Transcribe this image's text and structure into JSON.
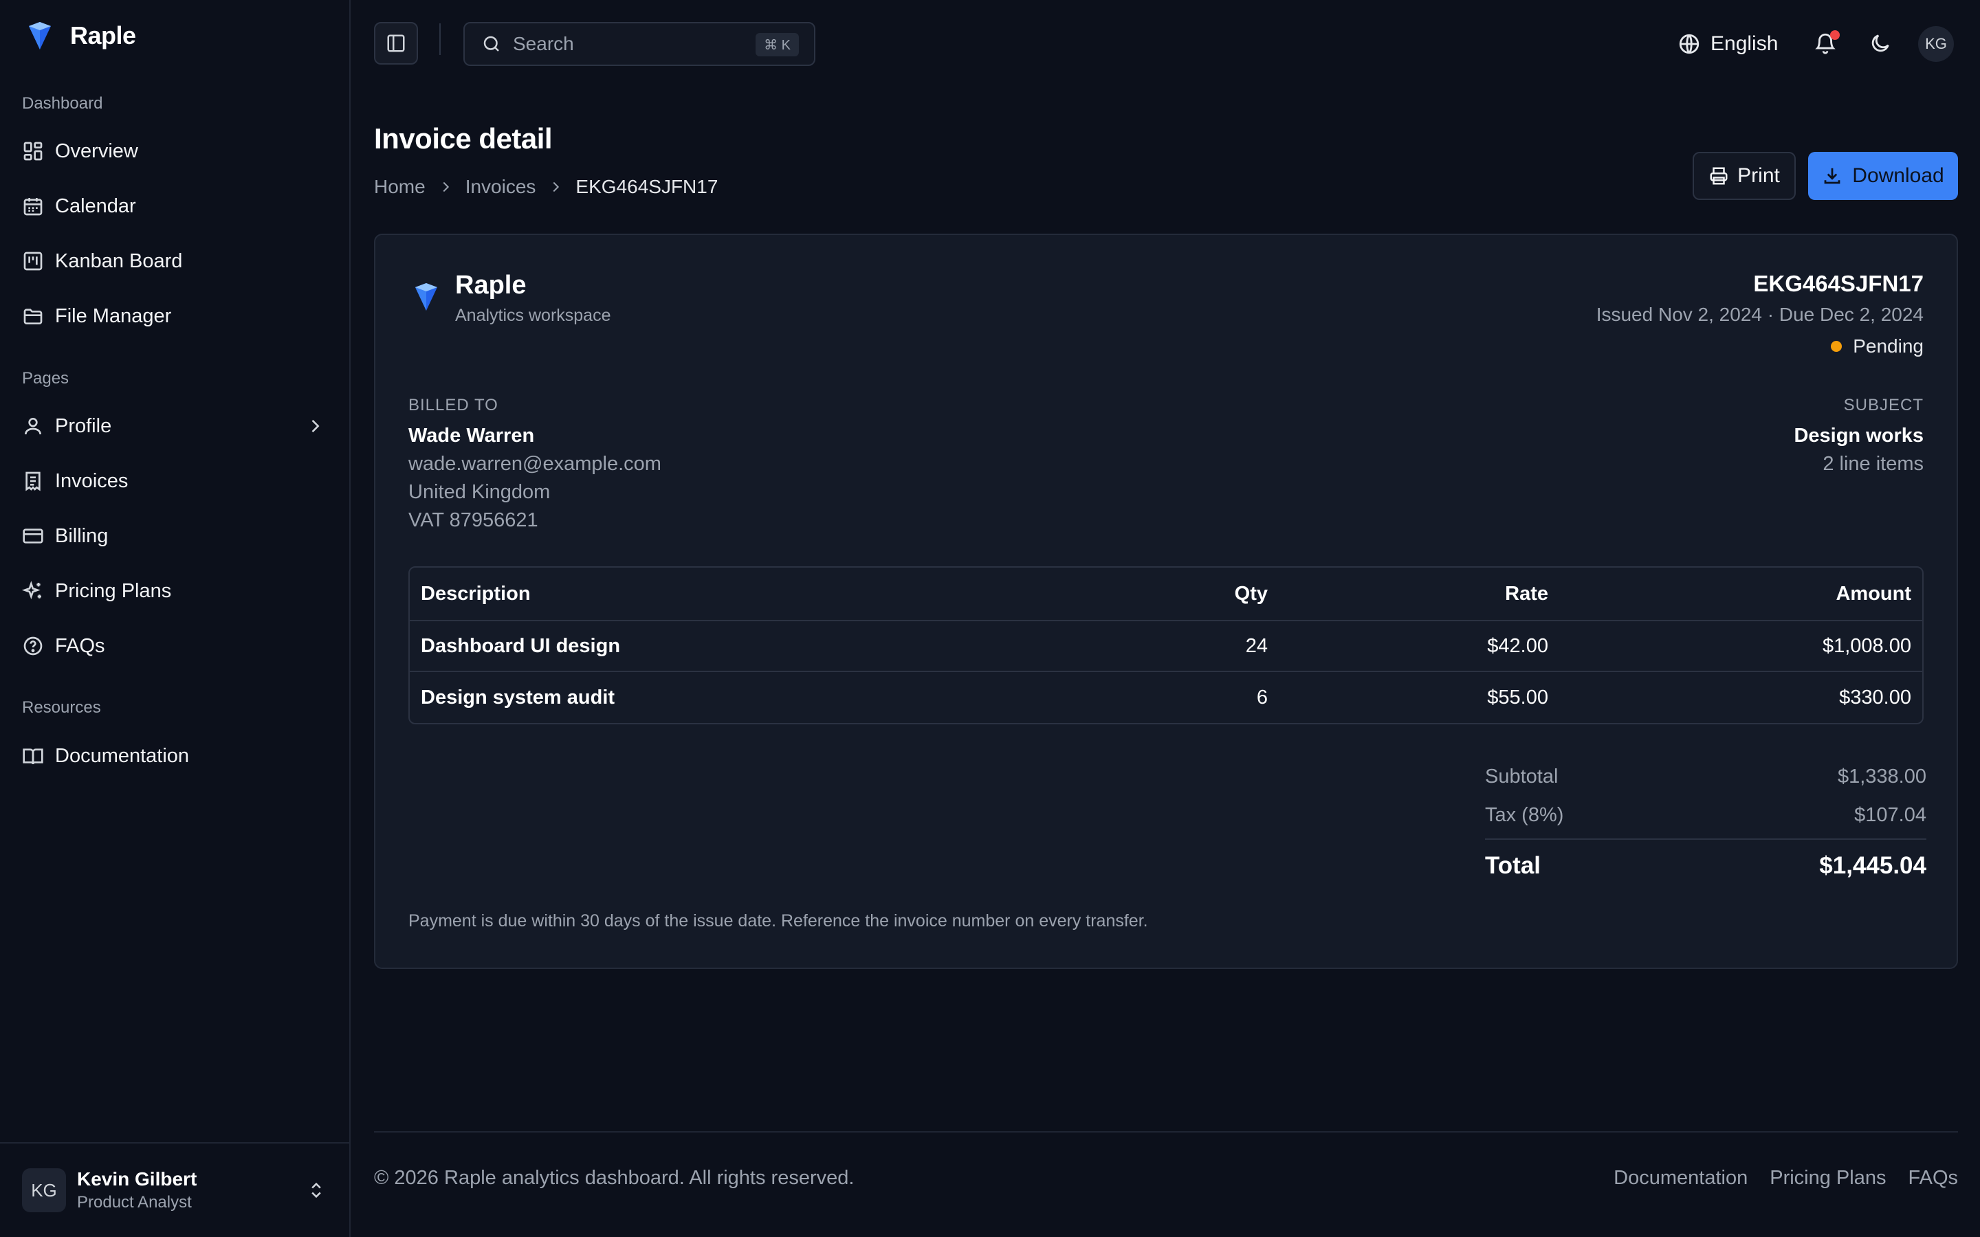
{
  "brand": {
    "name": "Raple",
    "accent": "#3b82f6"
  },
  "sidebar": {
    "sections": [
      {
        "label": "Dashboard",
        "items": [
          {
            "label": "Overview",
            "icon": "grid-icon"
          },
          {
            "label": "Calendar",
            "icon": "calendar-icon"
          },
          {
            "label": "Kanban Board",
            "icon": "kanban-icon"
          },
          {
            "label": "File Manager",
            "icon": "folder-icon"
          }
        ]
      },
      {
        "label": "Pages",
        "items": [
          {
            "label": "Profile",
            "icon": "user-icon",
            "has_submenu": true
          },
          {
            "label": "Invoices",
            "icon": "receipt-icon"
          },
          {
            "label": "Billing",
            "icon": "credit-card-icon"
          },
          {
            "label": "Pricing Plans",
            "icon": "sparkles-icon"
          },
          {
            "label": "FAQs",
            "icon": "help-circle-icon"
          }
        ]
      },
      {
        "label": "Resources",
        "items": [
          {
            "label": "Documentation",
            "icon": "book-icon"
          }
        ]
      }
    ],
    "user": {
      "initials": "KG",
      "name": "Kevin Gilbert",
      "role": "Product Analyst"
    }
  },
  "topbar": {
    "search_placeholder": "Search",
    "search_shortcut": "⌘ K",
    "language": "English",
    "avatar_initials": "KG",
    "has_notification": true
  },
  "page": {
    "title": "Invoice detail",
    "breadcrumbs": [
      "Home",
      "Invoices",
      "EKG464SJFN17"
    ],
    "print_label": "Print",
    "download_label": "Download"
  },
  "invoice": {
    "company": "Raple",
    "company_sub": "Analytics workspace",
    "number": "EKG464SJFN17",
    "dates": "Issued Nov 2, 2024 · Due Dec 2, 2024",
    "status": "Pending",
    "status_color": "#f59e0b",
    "billed_to_label": "BILLED TO",
    "billed_to": {
      "name": "Wade Warren",
      "email": "wade.warren@example.com",
      "country": "United Kingdom",
      "vat": "VAT 87956621"
    },
    "subject_label": "SUBJECT",
    "subject": "Design works",
    "line_count": "2 line items",
    "table": {
      "headers": [
        "Description",
        "Qty",
        "Rate",
        "Amount"
      ],
      "rows": [
        [
          "Dashboard UI design",
          "24",
          "$42.00",
          "$1,008.00"
        ],
        [
          "Design system audit",
          "6",
          "$55.00",
          "$330.00"
        ]
      ]
    },
    "subtotal_label": "Subtotal",
    "subtotal": "$1,338.00",
    "tax_label": "Tax (8%)",
    "tax": "$107.04",
    "total_label": "Total",
    "total": "$1,445.04",
    "note": "Payment is due within 30 days of the issue date. Reference the invoice number on every transfer."
  },
  "footer": {
    "copyright": "© 2026 Raple analytics dashboard. All rights reserved.",
    "links": [
      "Documentation",
      "Pricing Plans",
      "FAQs"
    ]
  }
}
